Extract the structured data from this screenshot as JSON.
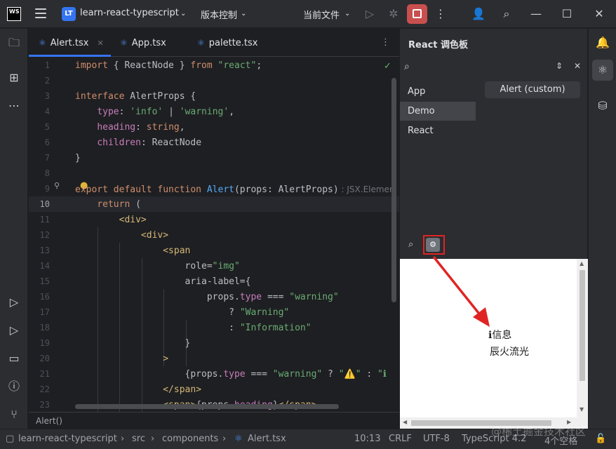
{
  "titlebar": {
    "logo": "WS",
    "project_badge": "LT",
    "project_name": "learn-react-typescript",
    "vcs_label": "版本控制",
    "run_config": "当前文件"
  },
  "editor": {
    "tabs": [
      {
        "label": "Alert.tsx",
        "active": true
      },
      {
        "label": "App.tsx",
        "active": false
      },
      {
        "label": "palette.tsx",
        "active": false
      }
    ],
    "current_line": 10,
    "line_numbers": [
      "1",
      "2",
      "3",
      "4",
      "5",
      "6",
      "7",
      "8",
      "9",
      "10",
      "11",
      "12",
      "13",
      "14",
      "15",
      "16",
      "17",
      "18",
      "19",
      "20",
      "21",
      "22",
      "23"
    ],
    "lines": [
      [
        {
          "t": "import",
          "c": "kw"
        },
        {
          "t": " { ReactNode } ",
          "c": ""
        },
        {
          "t": "from",
          "c": "kw"
        },
        {
          "t": " ",
          "c": ""
        },
        {
          "t": "\"react\"",
          "c": "str"
        },
        {
          "t": ";",
          "c": ""
        }
      ],
      [],
      [
        {
          "t": "interface",
          "c": "kw"
        },
        {
          "t": " AlertProps {",
          "c": ""
        }
      ],
      [
        {
          "t": "    ",
          "c": ""
        },
        {
          "t": "type",
          "c": "prop"
        },
        {
          "t": ": ",
          "c": ""
        },
        {
          "t": "'info'",
          "c": "str"
        },
        {
          "t": " | ",
          "c": ""
        },
        {
          "t": "'warning'",
          "c": "str"
        },
        {
          "t": ",",
          "c": ""
        }
      ],
      [
        {
          "t": "    ",
          "c": ""
        },
        {
          "t": "heading",
          "c": "prop"
        },
        {
          "t": ": ",
          "c": ""
        },
        {
          "t": "string",
          "c": "kw"
        },
        {
          "t": ",",
          "c": ""
        }
      ],
      [
        {
          "t": "    ",
          "c": ""
        },
        {
          "t": "children",
          "c": "prop"
        },
        {
          "t": ": ReactNode",
          "c": ""
        }
      ],
      [
        {
          "t": "}",
          "c": ""
        }
      ],
      [],
      [
        {
          "t": "export default function",
          "c": "kw"
        },
        {
          "t": " ",
          "c": ""
        },
        {
          "t": "Alert",
          "c": "fn"
        },
        {
          "t": "(props: AlertProps)",
          "c": ""
        },
        {
          "t": " : JSX.Element",
          "c": "hint"
        }
      ],
      [
        {
          "t": "    ",
          "c": ""
        },
        {
          "t": "return",
          "c": "kw"
        },
        {
          "t": " (",
          "c": ""
        }
      ],
      [
        {
          "t": "        ",
          "c": ""
        },
        {
          "t": "<div>",
          "c": "tag"
        }
      ],
      [
        {
          "t": "            ",
          "c": ""
        },
        {
          "t": "<div>",
          "c": "tag"
        }
      ],
      [
        {
          "t": "                ",
          "c": ""
        },
        {
          "t": "<span",
          "c": "tag"
        }
      ],
      [
        {
          "t": "                    role=",
          "c": ""
        },
        {
          "t": "\"img\"",
          "c": "str"
        }
      ],
      [
        {
          "t": "                    aria-label={",
          "c": ""
        }
      ],
      [
        {
          "t": "                        props.",
          "c": ""
        },
        {
          "t": "type",
          "c": "prop"
        },
        {
          "t": " === ",
          "c": ""
        },
        {
          "t": "\"warning\"",
          "c": "str"
        }
      ],
      [
        {
          "t": "                            ? ",
          "c": ""
        },
        {
          "t": "\"Warning\"",
          "c": "str"
        }
      ],
      [
        {
          "t": "                            : ",
          "c": ""
        },
        {
          "t": "\"Information\"",
          "c": "str"
        }
      ],
      [
        {
          "t": "                    }",
          "c": ""
        }
      ],
      [
        {
          "t": "                ",
          "c": ""
        },
        {
          "t": ">",
          "c": "tag"
        }
      ],
      [
        {
          "t": "                    {props.",
          "c": ""
        },
        {
          "t": "type",
          "c": "prop"
        },
        {
          "t": " === ",
          "c": ""
        },
        {
          "t": "\"warning\"",
          "c": "str"
        },
        {
          "t": " ? ",
          "c": ""
        },
        {
          "t": "\"⚠️\"",
          "c": "str"
        },
        {
          "t": " : ",
          "c": ""
        },
        {
          "t": "\"ℹ",
          "c": "str"
        }
      ],
      [
        {
          "t": "                ",
          "c": ""
        },
        {
          "t": "</span>",
          "c": "tag"
        }
      ],
      [
        {
          "t": "                ",
          "c": ""
        },
        {
          "t": "<span>",
          "c": "tag"
        },
        {
          "t": "{props.",
          "c": ""
        },
        {
          "t": "heading",
          "c": "prop"
        },
        {
          "t": "}",
          "c": ""
        },
        {
          "t": "</span>",
          "c": "tag"
        }
      ]
    ],
    "breadcrumb": "Alert()"
  },
  "palette": {
    "title": "React 调色板",
    "categories": [
      "App",
      "Demo",
      "React"
    ],
    "selected_category": "Demo",
    "component": "Alert (custom)",
    "preview_line1": "ℹ信息",
    "preview_line2": "辰火流光"
  },
  "statusbar": {
    "project": "learn-react-typescript",
    "path1": "src",
    "path2": "components",
    "file": "Alert.tsx",
    "position": "10:13",
    "line_sep": "CRLF",
    "encoding": "UTF-8",
    "language": "TypeScript 4.2",
    "indent": "4个空格"
  },
  "watermark": "@稀土掘金技术社区",
  "colors": {
    "accent": "#3574f0",
    "stop": "#c94f4f",
    "highlight": "#e02424"
  }
}
